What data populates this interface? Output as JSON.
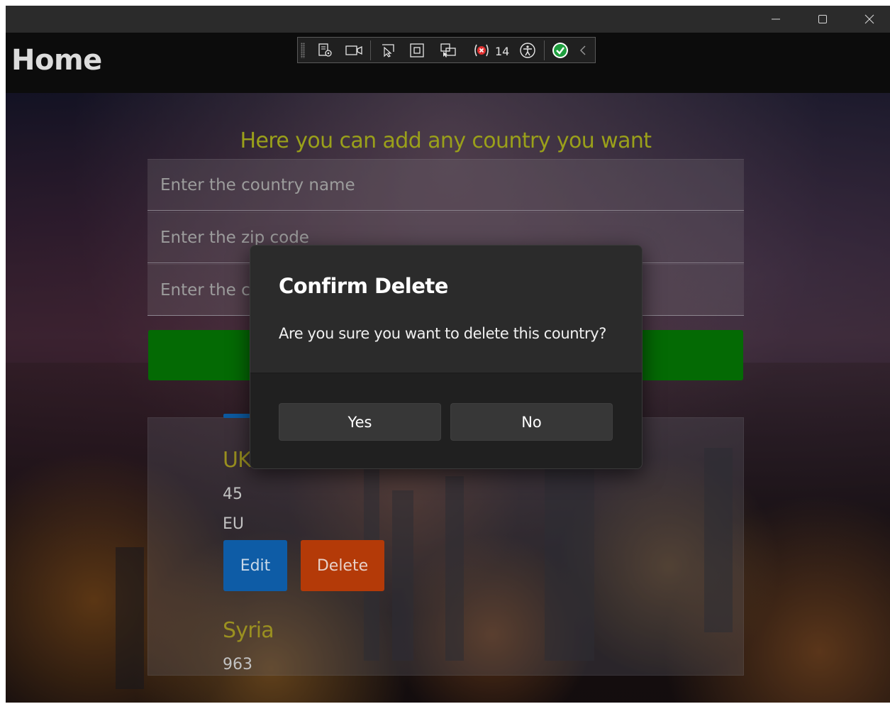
{
  "page": {
    "title": "Home",
    "heading": "Here you can add any country you want"
  },
  "window_controls": {
    "minimize_icon": "minimize-icon",
    "maximize_icon": "maximize-icon",
    "close_icon": "close-icon"
  },
  "debug_toolbar": {
    "error_count": "14",
    "icons": [
      "live-visual-tree-icon",
      "record-icon",
      "select-element-icon",
      "display-layout-adorners-icon",
      "track-focus-icon",
      "binding-failures-icon",
      "accessibility-icon",
      "hot-reload-ok-icon",
      "collapse-chevron-icon"
    ]
  },
  "form": {
    "country_name_placeholder": "Enter the country name",
    "zip_code_placeholder": "Enter the zip code",
    "continent_placeholder": "Enter the continent"
  },
  "countries": [
    {
      "name": "UK",
      "code": "45",
      "region": "EU"
    },
    {
      "name": "Syria",
      "code": "963"
    }
  ],
  "item_actions": {
    "edit_label": "Edit",
    "delete_label": "Delete"
  },
  "dialog": {
    "title": "Confirm Delete",
    "message": "Are you sure you want to delete this country?",
    "yes_label": "Yes",
    "no_label": "No"
  },
  "colors": {
    "heading_accent": "#9aa01a",
    "submit_green": "#046a04",
    "edit_blue": "#0e5ca6",
    "delete_orange": "#b43a08",
    "dialog_bg": "#2b2b2b"
  }
}
